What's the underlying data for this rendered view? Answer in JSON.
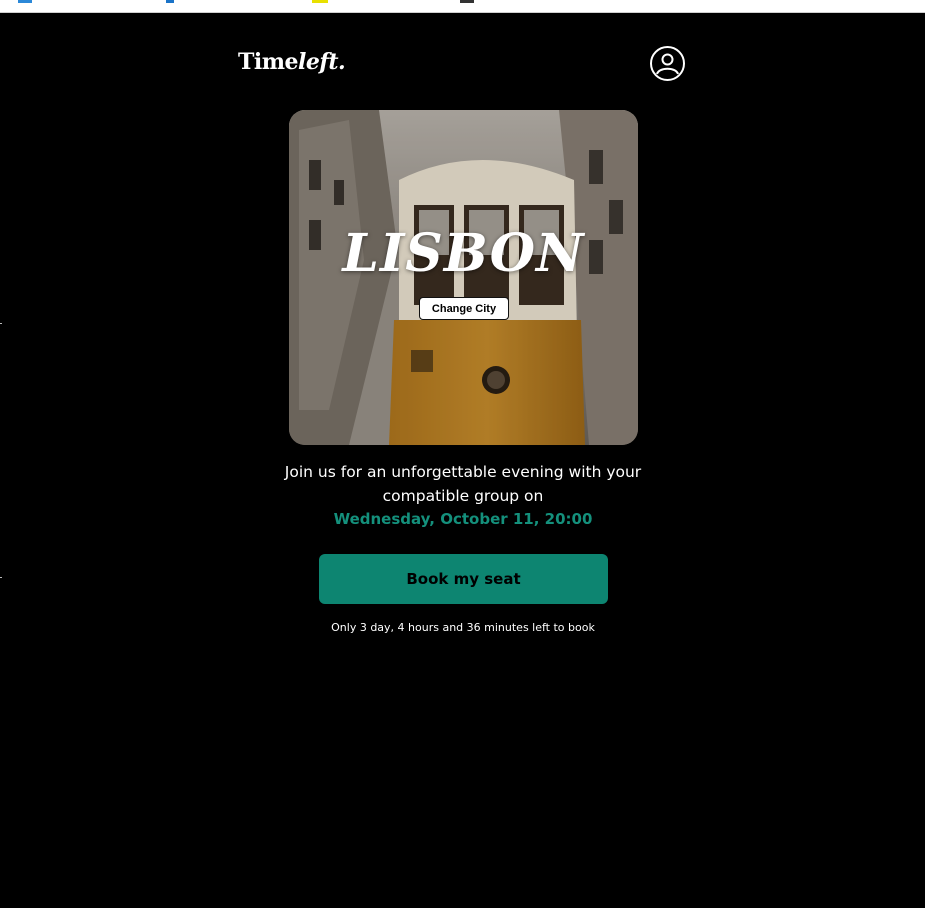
{
  "header": {
    "logo_time": "Time",
    "logo_left": "left.",
    "profile_icon": "user-circle-icon"
  },
  "hero": {
    "city": "LISBON",
    "change_city_label": "Change City"
  },
  "event": {
    "invite_text": "Join us for an unforgettable evening with your compatible group on",
    "date_text": "Wednesday, October 11, 20:00",
    "book_label": "Book my seat",
    "countdown_text": "Only 3 day, 4 hours and 36 minutes left to book"
  },
  "colors": {
    "accent": "#0d8571",
    "accent_text": "#14907c",
    "background": "#000000"
  }
}
